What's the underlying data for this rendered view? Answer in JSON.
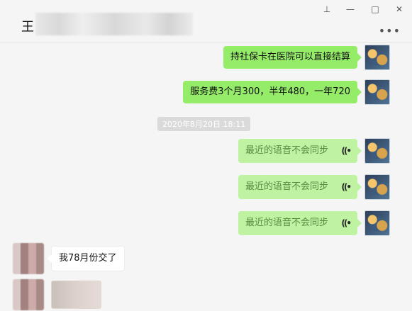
{
  "header": {
    "title_initial": "王"
  },
  "window_controls": [
    "pin-icon",
    "minimize-icon",
    "maximize-icon",
    "close-icon"
  ],
  "messages": [
    {
      "text": "持社保卡在医院可以直接结算"
    },
    {
      "text": "服务费3个月300，半年480，一年720"
    }
  ],
  "timestamp": "2020年8月20日 18:11",
  "voice_messages": [
    {
      "text": "最近的语音不会同步"
    },
    {
      "text": "最近的语音不会同步"
    },
    {
      "text": "最近的语音不会同步"
    }
  ],
  "left_messages": [
    {
      "text": "我78月份交了"
    }
  ]
}
